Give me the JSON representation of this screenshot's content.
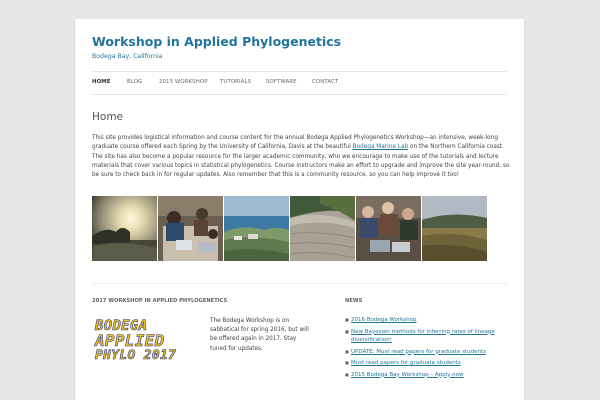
{
  "site": {
    "title": "Workshop in Applied Phylogenetics",
    "description": "Bodega Bay, California"
  },
  "nav": {
    "items": [
      {
        "label": "Home",
        "active": true
      },
      {
        "label": "Blog"
      },
      {
        "label": "2015 Workshop"
      },
      {
        "label": "Tutorials"
      },
      {
        "label": "Software"
      },
      {
        "label": "Contact"
      }
    ]
  },
  "page": {
    "title": "Home",
    "intro_before_link": "This site provides logistical information and course content for the annual Bodega Applied Phylogenetics Workshop—an intensive, week-long graduate course offered each Spring by the University of California, Davis at the beautiful ",
    "intro_link": "Bodega Marine Lab",
    "intro_after_link": " on the Northern California coast. The site has also become a popular resource for the larger academic community, who we encourage to make use of the tutorials and lecture materials that cover various topics in statistical phylogenetics. Course instructors make an effort to upgrade and improve the site year-round, so be sure to check back in for regular updates. Also remember that this is a community resource, so you can help improve it too!"
  },
  "gallery": {
    "photos": [
      {
        "name": "photo-sunset-tree"
      },
      {
        "name": "photo-students-laptops"
      },
      {
        "name": "photo-bay-aerial"
      },
      {
        "name": "photo-beach-dunes"
      },
      {
        "name": "photo-group-meeting"
      },
      {
        "name": "photo-grassland"
      }
    ]
  },
  "widgets": {
    "left_title": "2017 Workshop in Applied Phylogenetics",
    "logo_lines": [
      "BODEGA",
      "APPLIED",
      "PHYLO 2017"
    ],
    "text": "The Bodega Workshop is on sabbatical for spring 2016, but will be offered again in 2017. Stay tuned for updates.",
    "news_title": "News",
    "news": [
      "2016 Bodega Workshop",
      "New Bayesian methods for inferring rates of lineage diversification!",
      "UPDATE: Must read papers for graduate students",
      "Must read papers for graduate students",
      "2015 Bodega Bay Workshop – Apply now"
    ]
  },
  "colors": {
    "link": "#21759b",
    "background": "#e6e6e6",
    "logo_yellow": "#f3c316",
    "logo_blue": "#2c3a8e"
  }
}
